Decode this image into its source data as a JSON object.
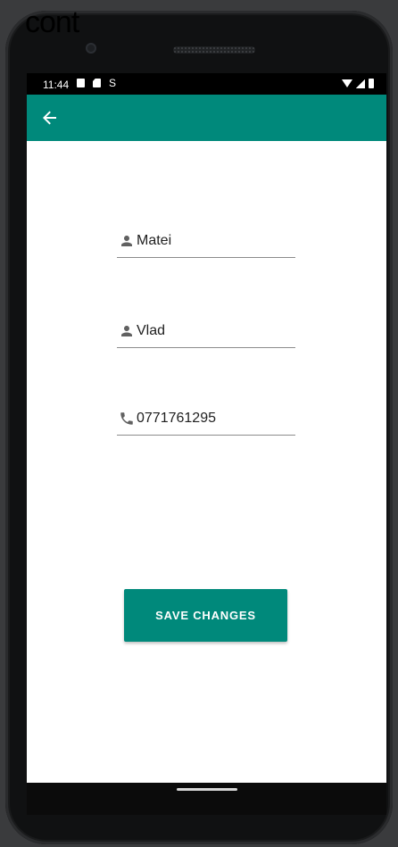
{
  "overlay": {
    "text": "cont"
  },
  "status_bar": {
    "time": "11:44",
    "left_icons": [
      "notification-a-icon",
      "sd-card-icon",
      "s-icon"
    ],
    "s_glyph": "S",
    "right_icons": [
      "wifi-icon",
      "signal-icon",
      "battery-icon"
    ]
  },
  "app_bar": {
    "color": "#00897b",
    "back_icon": "arrow-back-icon"
  },
  "form": {
    "first_name": {
      "value": "Matei",
      "icon": "person-icon"
    },
    "last_name": {
      "value": "Vlad",
      "icon": "person-icon"
    },
    "phone": {
      "value": "0771761295",
      "icon": "phone-icon"
    }
  },
  "save_button": {
    "label": "SAVE CHANGES",
    "color": "#00897b"
  }
}
